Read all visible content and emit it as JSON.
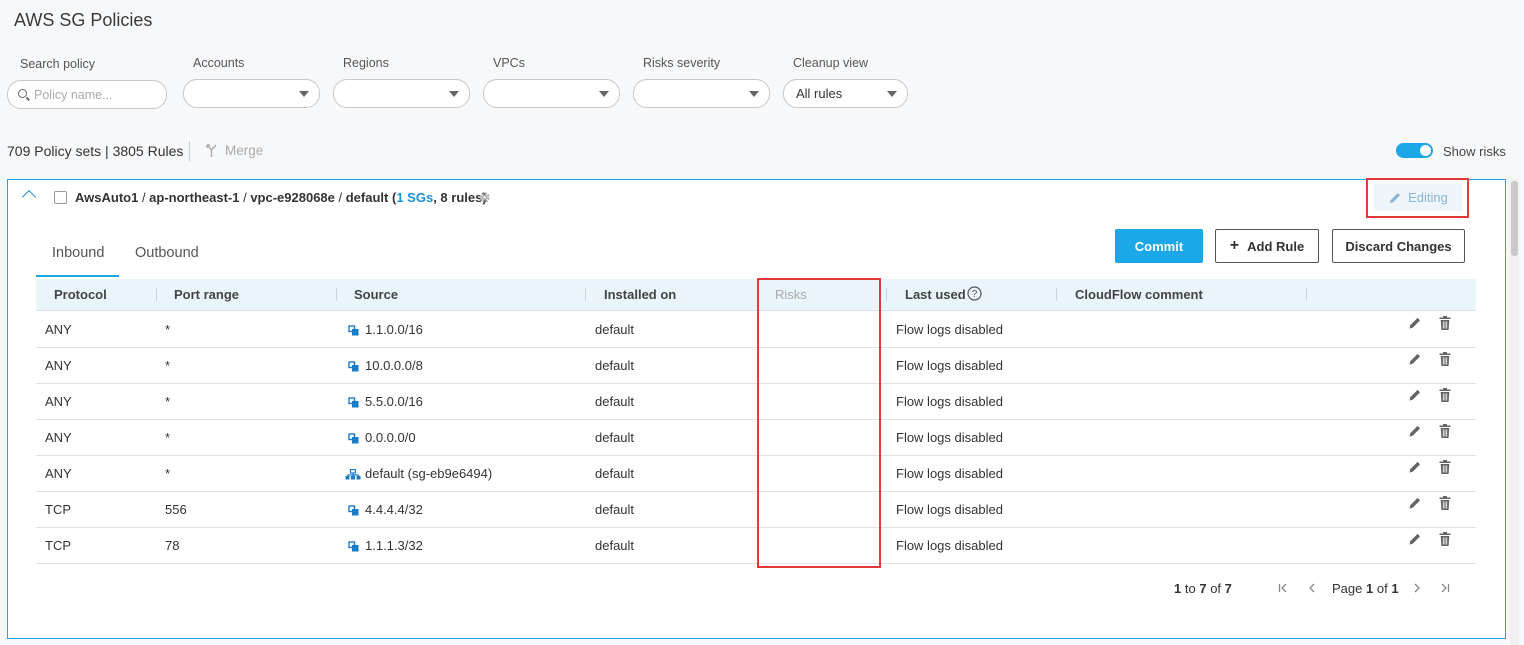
{
  "page": {
    "title": "AWS SG Policies"
  },
  "filters": {
    "search": {
      "label": "Search policy",
      "placeholder": "Policy name..."
    },
    "accounts": {
      "label": "Accounts",
      "value": ""
    },
    "regions": {
      "label": "Regions",
      "value": ""
    },
    "vpcs": {
      "label": "VPCs",
      "value": ""
    },
    "risks_severity": {
      "label": "Risks severity",
      "value": ""
    },
    "cleanup_view": {
      "label": "Cleanup view",
      "value": "All rules"
    }
  },
  "summary": {
    "counts": "709 Policy sets | 3805 Rules",
    "merge_label": "Merge"
  },
  "show_risks": {
    "label": "Show risks",
    "enabled": true
  },
  "policy_set": {
    "account": "AwsAuto1",
    "region": "ap-northeast-1",
    "vpc": "vpc-e928068e",
    "name": "default",
    "sg_count": "1 SGs",
    "rules_count": "8 rules",
    "status": "Editing"
  },
  "tabs": [
    {
      "label": "Inbound",
      "active": true
    },
    {
      "label": "Outbound",
      "active": false
    }
  ],
  "actions": {
    "commit": "Commit",
    "add_rule": "Add Rule",
    "discard": "Discard Changes"
  },
  "table": {
    "columns": [
      "Protocol",
      "Port range",
      "Source",
      "Installed on",
      "Risks",
      "Last used",
      "CloudFlow comment"
    ],
    "rows": [
      {
        "protocol": "ANY",
        "port": "*",
        "source": "1.1.0.0/16",
        "source_icon": "ip-range-icon",
        "installed_on": "default",
        "risks": "",
        "last_used": "Flow logs disabled",
        "comment": ""
      },
      {
        "protocol": "ANY",
        "port": "*",
        "source": "10.0.0.0/8",
        "source_icon": "ip-range-icon",
        "installed_on": "default",
        "risks": "",
        "last_used": "Flow logs disabled",
        "comment": ""
      },
      {
        "protocol": "ANY",
        "port": "*",
        "source": "5.5.0.0/16",
        "source_icon": "ip-range-icon",
        "installed_on": "default",
        "risks": "",
        "last_used": "Flow logs disabled",
        "comment": ""
      },
      {
        "protocol": "ANY",
        "port": "*",
        "source": "0.0.0.0/0",
        "source_icon": "ip-range-icon",
        "installed_on": "default",
        "risks": "",
        "last_used": "Flow logs disabled",
        "comment": ""
      },
      {
        "protocol": "ANY",
        "port": "*",
        "source": "default (sg-eb9e6494)",
        "source_icon": "security-group-icon",
        "installed_on": "default",
        "risks": "",
        "last_used": "Flow logs disabled",
        "comment": ""
      },
      {
        "protocol": "TCP",
        "port": "556",
        "source": "4.4.4.4/32",
        "source_icon": "ip-range-icon",
        "installed_on": "default",
        "risks": "",
        "last_used": "Flow logs disabled",
        "comment": ""
      },
      {
        "protocol": "TCP",
        "port": "78",
        "source": "1.1.1.3/32",
        "source_icon": "ip-range-icon",
        "installed_on": "default",
        "risks": "",
        "last_used": "Flow logs disabled",
        "comment": ""
      }
    ]
  },
  "pagination": {
    "from": "1",
    "to": "7",
    "total": "7",
    "page": "1",
    "pages": "1",
    "to_word": "to",
    "of_word": "of",
    "page_word": "Page"
  },
  "colors": {
    "accent": "#1ca7e8",
    "highlight": "#e23a3a"
  }
}
